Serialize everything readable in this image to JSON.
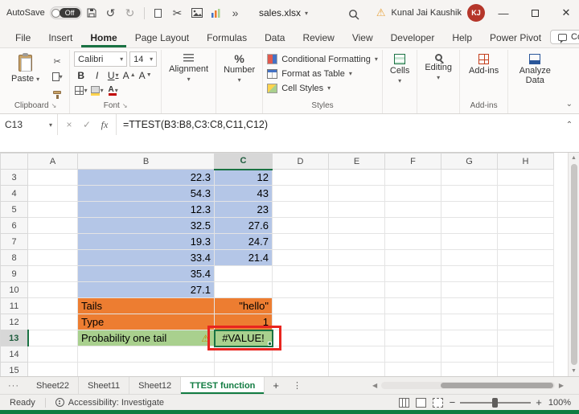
{
  "colors": {
    "accent_green": "#1a7243",
    "fill_blue": "#b4c6e7",
    "fill_orange": "#ed7d31",
    "fill_green": "#a9d08e",
    "annotation_red": "#e8251f",
    "avatar_red": "#b5362a"
  },
  "titlebar": {
    "autosave_label": "AutoSave",
    "autosave_state": "Off",
    "filename": "sales.xlsx",
    "user_name": "Kunal Jai Kaushik",
    "user_initials": "KJ"
  },
  "ribbon_tabs": {
    "items": [
      {
        "label": "File",
        "active": false
      },
      {
        "label": "Insert",
        "active": false
      },
      {
        "label": "Home",
        "active": true
      },
      {
        "label": "Page Layout",
        "active": false
      },
      {
        "label": "Formulas",
        "active": false
      },
      {
        "label": "Data",
        "active": false
      },
      {
        "label": "Review",
        "active": false
      },
      {
        "label": "View",
        "active": false
      },
      {
        "label": "Developer",
        "active": false
      },
      {
        "label": "Help",
        "active": false
      },
      {
        "label": "Power Pivot",
        "active": false
      }
    ],
    "comments_label": "Comments"
  },
  "ribbon": {
    "paste_label": "Paste",
    "clipboard_group_label": "Clipboard",
    "font_name": "Calibri",
    "font_size": "14",
    "bold_label": "B",
    "italic_label": "I",
    "underline_label": "U",
    "font_glyph": "A",
    "font_group_label": "Font",
    "alignment_label": "Alignment",
    "number_label": "Number",
    "conditional_formatting_label": "Conditional Formatting",
    "format_as_table_label": "Format as Table",
    "cell_styles_label": "Cell Styles",
    "styles_group_label": "Styles",
    "cells_label": "Cells",
    "editing_label": "Editing",
    "addins_label": "Add-ins",
    "addins_group_label": "Add-ins",
    "analyze_data_label": "Analyze Data"
  },
  "formula_bar": {
    "name_box": "C13",
    "fx_label": "fx",
    "formula": "=TTEST(B3:B8,C3:C8,C11,C12)"
  },
  "grid": {
    "column_headers": [
      "A",
      "B",
      "C",
      "D",
      "E",
      "F",
      "G",
      "H"
    ],
    "selected_column": "C",
    "selected_row": "13",
    "rows": [
      {
        "n": "3",
        "b": {
          "v": "22.3",
          "fill": "blue",
          "align": "right"
        },
        "c": {
          "v": "12",
          "fill": "blue",
          "align": "right"
        }
      },
      {
        "n": "4",
        "b": {
          "v": "54.3",
          "fill": "blue",
          "align": "right"
        },
        "c": {
          "v": "43",
          "fill": "blue",
          "align": "right"
        }
      },
      {
        "n": "5",
        "b": {
          "v": "12.3",
          "fill": "blue",
          "align": "right"
        },
        "c": {
          "v": "23",
          "fill": "blue",
          "align": "right"
        }
      },
      {
        "n": "6",
        "b": {
          "v": "32.5",
          "fill": "blue",
          "align": "right"
        },
        "c": {
          "v": "27.6",
          "fill": "blue",
          "align": "right"
        }
      },
      {
        "n": "7",
        "b": {
          "v": "19.3",
          "fill": "blue",
          "align": "right"
        },
        "c": {
          "v": "24.7",
          "fill": "blue",
          "align": "right"
        }
      },
      {
        "n": "8",
        "b": {
          "v": "33.4",
          "fill": "blue",
          "align": "right"
        },
        "c": {
          "v": "21.4",
          "fill": "blue",
          "align": "right"
        }
      },
      {
        "n": "9",
        "b": {
          "v": "35.4",
          "fill": "blue",
          "align": "right"
        },
        "c": null
      },
      {
        "n": "10",
        "b": {
          "v": "27.1",
          "fill": "blue",
          "align": "right"
        },
        "c": null
      },
      {
        "n": "11",
        "b": {
          "v": "Tails",
          "fill": "orange",
          "align": "left"
        },
        "c": {
          "v": "\"hello\"",
          "fill": "orange",
          "align": "right"
        }
      },
      {
        "n": "12",
        "b": {
          "v": "Type",
          "fill": "orange",
          "align": "left"
        },
        "c": {
          "v": "1",
          "fill": "orange",
          "align": "right"
        }
      },
      {
        "n": "13",
        "b": {
          "v": "Probability one tail",
          "fill": "green",
          "align": "left",
          "warn": true
        },
        "c": {
          "v": "#VALUE!",
          "fill": "green",
          "align": "center",
          "selected": true
        }
      },
      {
        "n": "14",
        "b": null,
        "c": null
      },
      {
        "n": "15",
        "b": {
          "v": "",
          "box": true
        },
        "c": {
          "v": "",
          "box": true
        }
      }
    ]
  },
  "sheet_bar": {
    "tabs": [
      {
        "label": "Sheet22",
        "active": false
      },
      {
        "label": "Sheet11",
        "active": false
      },
      {
        "label": "Sheet12",
        "active": false
      },
      {
        "label": "TTEST function",
        "active": true
      }
    ]
  },
  "status_bar": {
    "ready_label": "Ready",
    "accessibility_label": "Accessibility: Investigate",
    "zoom_level": "100%"
  }
}
